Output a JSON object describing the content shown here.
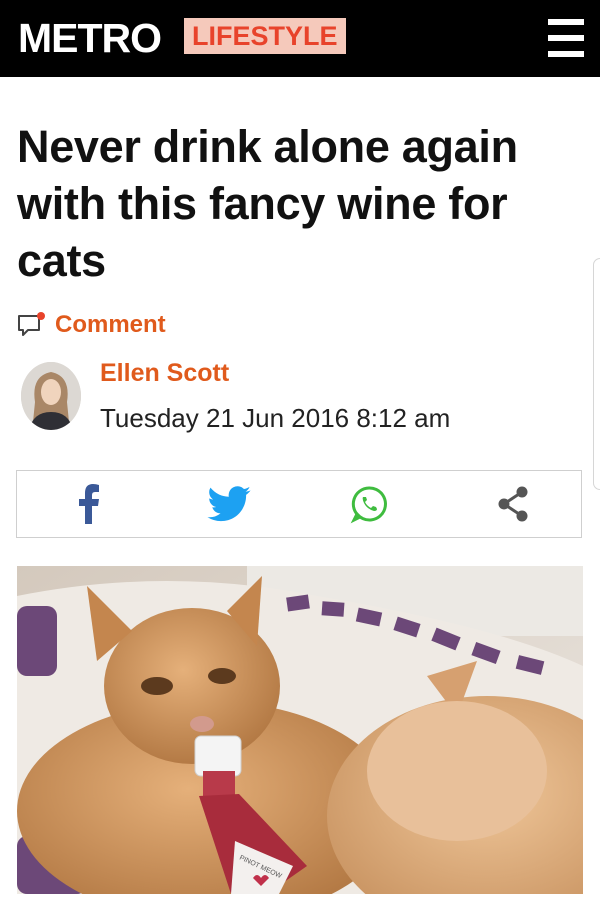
{
  "header": {
    "brand": "METRO",
    "section": "LIFESTYLE",
    "menu_icon": "hamburger-menu-icon"
  },
  "article": {
    "headline": "Never drink alone again with this fancy wine for cats",
    "comment_label": "Comment",
    "author": "Ellen Scott",
    "date": "Tuesday 21 Jun 2016 8:12 am"
  },
  "share": {
    "icons": [
      "facebook-icon",
      "twitter-icon",
      "whatsapp-icon",
      "share-icon"
    ]
  },
  "colors": {
    "header_bg": "#000000",
    "section_badge_bg": "#f5c9bb",
    "section_badge_text": "#e8432b",
    "accent_orange": "#e05a1c",
    "facebook": "#3b5998",
    "twitter": "#1da1f2",
    "whatsapp": "#3fbc3f"
  },
  "hero_image": {
    "subject": "ginger kittens with a small bottle of cat wine on a cushion",
    "bottle_label": "PINOT MEOW"
  }
}
